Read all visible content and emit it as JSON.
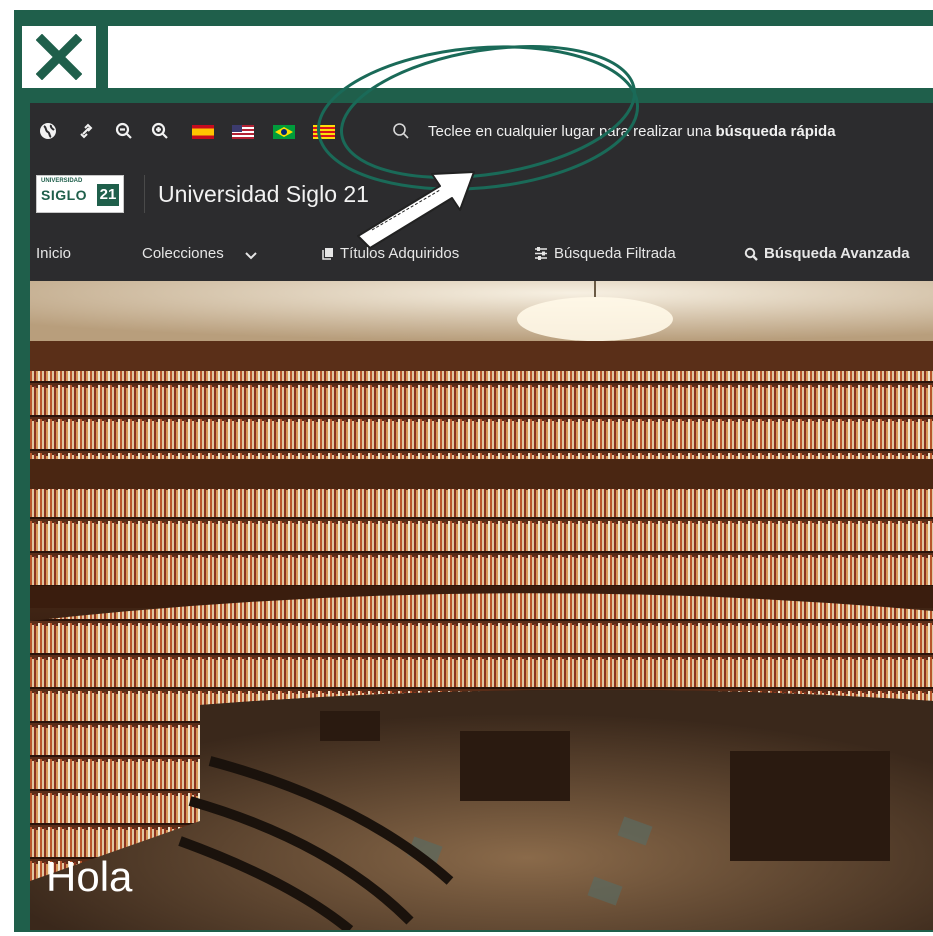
{
  "window": {
    "close_icon": "close-x-icon",
    "url_value": ""
  },
  "toolbar": {
    "icons": [
      "globe-icon",
      "link-icon",
      "zoom-out-icon",
      "zoom-in-icon"
    ],
    "flags": [
      "flag-spain",
      "flag-usa",
      "flag-brazil",
      "flag-catalonia"
    ],
    "search_hint_prefix": "Teclee en cualquier lugar para realizar una",
    "search_hint_bold": "búsqueda rápida"
  },
  "brand": {
    "logo_small": "UNIVERSIDAD",
    "logo_main": "SIGLO",
    "logo_num": "21",
    "title": "Universidad Siglo 21"
  },
  "nav": {
    "items": [
      {
        "label": "Inicio"
      },
      {
        "label": "Colecciones",
        "icon": "chevron-down-icon"
      },
      {
        "label": "Títulos Adquiridos",
        "icon": "book-icon"
      },
      {
        "label": "Búsqueda Filtrada",
        "icon": "filter-icon"
      },
      {
        "label": "Búsqueda Avanzada",
        "icon": "search-icon"
      }
    ]
  },
  "hero": {
    "greeting": "Hola",
    "subtext": ""
  },
  "colors": {
    "frame": "#1f5f4b",
    "toolbar_bg": "#2c2c2e",
    "annotation": "#1a6a58"
  }
}
